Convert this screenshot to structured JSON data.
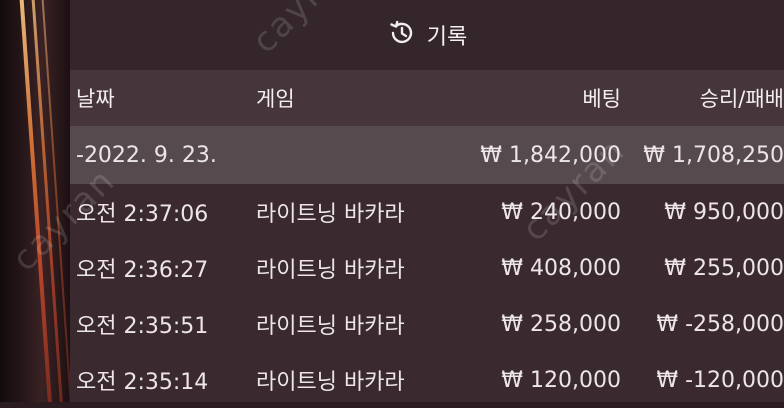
{
  "header": {
    "title": "기록",
    "icon": "history-icon"
  },
  "columns": {
    "date": "날짜",
    "game": "게임",
    "bet": "베팅",
    "result": "승리/패배"
  },
  "total": {
    "date": "-2022. 9. 23.",
    "bet": "₩ 1,842,000",
    "result": "₩ 1,708,250"
  },
  "rows": [
    {
      "time": "오전 2:37:06",
      "game": "라이트닝 바카라",
      "bet": "₩ 240,000",
      "result": "₩ 950,000"
    },
    {
      "time": "오전 2:36:27",
      "game": "라이트닝 바카라",
      "bet": "₩ 408,000",
      "result": "₩ 255,000"
    },
    {
      "time": "오전 2:35:51",
      "game": "라이트닝 바카라",
      "bet": "₩ 258,000",
      "result": "₩ -258,000"
    },
    {
      "time": "오전 2:35:14",
      "game": "라이트닝 바카라",
      "bet": "₩ 120,000",
      "result": "₩ -120,000"
    }
  ],
  "watermark": "cayran"
}
